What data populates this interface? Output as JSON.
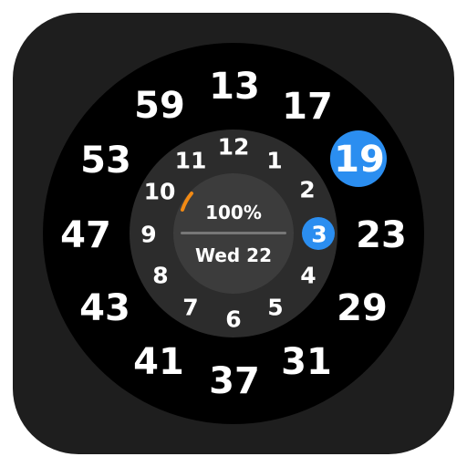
{
  "watch_face": {
    "minute_ring": [
      "13",
      "17",
      "19",
      "23",
      "29",
      "31",
      "37",
      "41",
      "43",
      "47",
      "53",
      "59"
    ],
    "hour_ring": [
      "12",
      "1",
      "2",
      "3",
      "4",
      "5",
      "6",
      "7",
      "8",
      "9",
      "10",
      "11"
    ],
    "active_minute": "19",
    "active_hour": "3",
    "battery_percent": "100%",
    "date": "Wed 22",
    "colors": {
      "tile_bg": "#1e1e1e",
      "outer_ring": "#000000",
      "inner_ring": "#2c2c2c",
      "center": "#3c3c3c",
      "highlight": "#2b8ef0",
      "progress_arc": "#f28a14"
    }
  }
}
